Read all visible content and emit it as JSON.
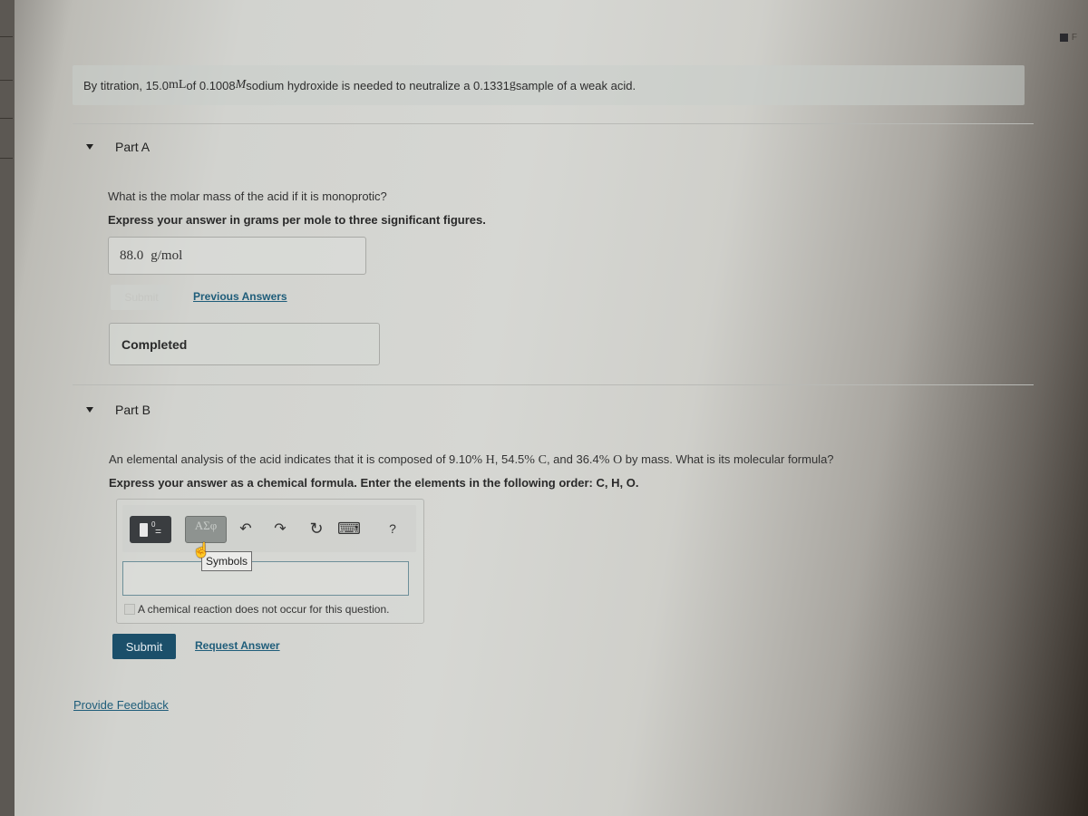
{
  "problem": {
    "intro_parts": [
      "By titration, 15.0 ",
      "mL",
      " of 0.1008 ",
      "M",
      " sodium hydroxide is needed to neutralize a 0.1331 ",
      "g",
      " sample of a weak acid."
    ]
  },
  "part_a": {
    "label": "Part A",
    "question": "What is the molar mass of the acid if it is monoprotic?",
    "instruction": "Express your answer in grams per mole to three significant figures.",
    "answer_value": "88.0",
    "answer_unit": "g/mol",
    "submit_label": "Submit",
    "previous_answers_label": "Previous Answers",
    "status": "Completed"
  },
  "part_b": {
    "label": "Part B",
    "question_parts": [
      "An elemental analysis of the acid indicates that it is composed of 9.10",
      "%",
      " ",
      "H",
      ", 54.5",
      "%",
      " ",
      "C",
      ", and 36.4",
      "%",
      " ",
      "O",
      " by mass. What is its molecular formula?"
    ],
    "instruction": "Express your answer as a chemical formula. Enter the elements in the following order: C, H, O.",
    "toolbar": {
      "template_sup": "0",
      "symbols_label": "ΑΣφ",
      "tooltip": "Symbols",
      "undo_icon": "↶",
      "redo_icon": "↷",
      "reset_icon": "↻",
      "keyboard_icon": "⌨",
      "help_icon": "?"
    },
    "input_value": "",
    "no_reaction_label": "A chemical reaction does not occur for this question.",
    "submit_label": "Submit",
    "request_answer_label": "Request Answer"
  },
  "feedback_label": "Provide Feedback",
  "corner_label": "F"
}
